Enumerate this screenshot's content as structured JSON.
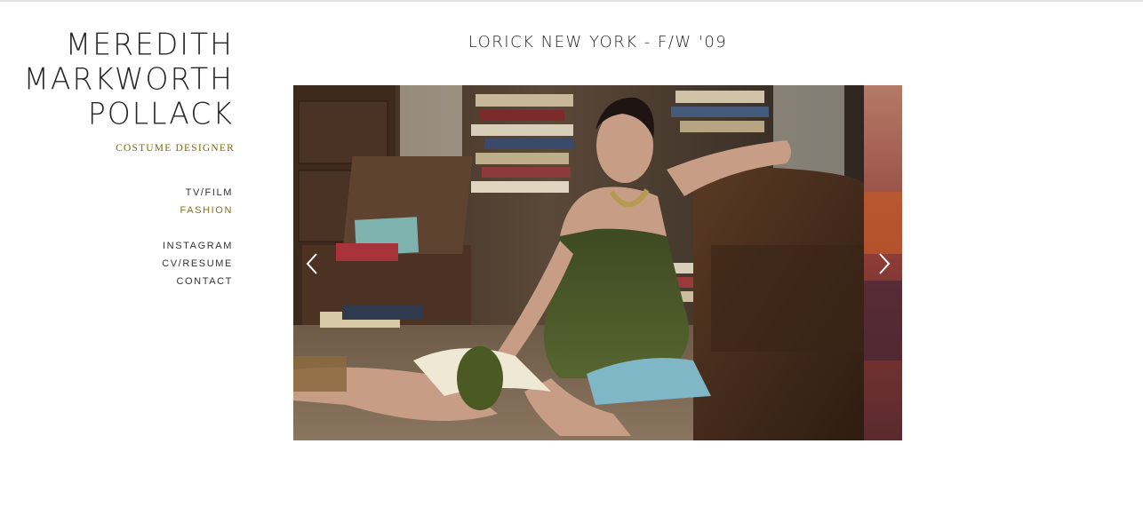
{
  "site": {
    "name_lines": [
      "MEREDITH",
      "MARKWORTH",
      "POLLACK"
    ],
    "subtitle": "COSTUME DESIGNER"
  },
  "nav": {
    "primary": [
      {
        "label": "TV/FILM",
        "active": false
      },
      {
        "label": "FASHION",
        "active": true
      }
    ],
    "secondary": [
      {
        "label": "INSTAGRAM"
      },
      {
        "label": "CV/RESUME"
      },
      {
        "label": "CONTACT"
      }
    ]
  },
  "gallery": {
    "title": "LORICK NEW YORK - F/W '09",
    "icons": {
      "prev": "chevron-left-icon",
      "next": "chevron-right-icon"
    }
  },
  "colors": {
    "accent": "#8a7414",
    "text": "#262626",
    "background": "#ffffff"
  }
}
